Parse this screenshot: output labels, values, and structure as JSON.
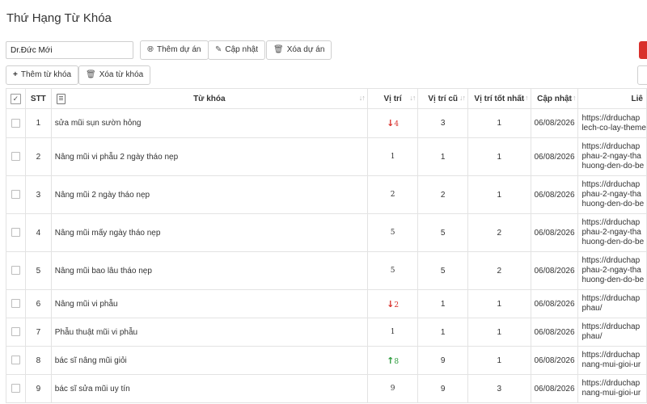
{
  "page": {
    "title": "Thứ Hạng Từ Khóa"
  },
  "project": {
    "selected": "Dr.Đức Mới"
  },
  "toolbar": {
    "add_project": "Thêm dự án",
    "update": "Cập nhật",
    "delete_project": "Xóa dự án",
    "add_keyword": "Thêm từ khóa",
    "delete_keyword": "Xóa từ khóa"
  },
  "colors": {
    "down": "#d9302c",
    "up": "#2a9a3a",
    "danger_button": "#d9302c"
  },
  "table": {
    "headers": {
      "stt": "STT",
      "keyword": "Từ khóa",
      "position": "Vị trí",
      "old_position": "Vị trí cũ",
      "best_position": "Vị trí tốt nhất",
      "updated": "Cập nhật",
      "link": "Liê"
    },
    "rows": [
      {
        "stt": "1",
        "keyword": "sửa mũi sụn sườn hỏng",
        "trend": "down",
        "position": "4",
        "old": "3",
        "best": "1",
        "date": "06/08/2026",
        "url": [
          "https://drduchap",
          "lech-co-lay-theme"
        ]
      },
      {
        "stt": "2",
        "keyword": "Nâng mũi vi phẫu 2 ngày tháo nẹp",
        "trend": "",
        "position": "1",
        "old": "1",
        "best": "1",
        "date": "06/08/2026",
        "url": [
          "https://drduchap",
          "phau-2-ngay-tha",
          "huong-den-do-be"
        ]
      },
      {
        "stt": "3",
        "keyword": "Nâng mũi 2 ngày tháo nẹp",
        "trend": "",
        "position": "2",
        "old": "2",
        "best": "1",
        "date": "06/08/2026",
        "url": [
          "https://drduchap",
          "phau-2-ngay-tha",
          "huong-den-do-be"
        ]
      },
      {
        "stt": "4",
        "keyword": "Nâng mũi mấy ngày tháo nẹp",
        "trend": "",
        "position": "5",
        "old": "5",
        "best": "2",
        "date": "06/08/2026",
        "url": [
          "https://drduchap",
          "phau-2-ngay-tha",
          "huong-den-do-be"
        ]
      },
      {
        "stt": "5",
        "keyword": "Nâng mũi bao lâu tháo nẹp",
        "trend": "",
        "position": "5",
        "old": "5",
        "best": "2",
        "date": "06/08/2026",
        "url": [
          "https://drduchap",
          "phau-2-ngay-tha",
          "huong-den-do-be"
        ]
      },
      {
        "stt": "6",
        "keyword": "Nâng mũi vi phẫu",
        "trend": "down",
        "position": "2",
        "old": "1",
        "best": "1",
        "date": "06/08/2026",
        "url": [
          "https://drduchap",
          "phau/"
        ]
      },
      {
        "stt": "7",
        "keyword": "Phẫu thuật mũi vi phẫu",
        "trend": "",
        "position": "1",
        "old": "1",
        "best": "1",
        "date": "06/08/2026",
        "url": [
          "https://drduchap",
          "phau/"
        ]
      },
      {
        "stt": "8",
        "keyword": "bác sĩ nâng mũi giỏi",
        "trend": "up",
        "position": "8",
        "old": "9",
        "best": "1",
        "date": "06/08/2026",
        "url": [
          "https://drduchap",
          "nang-mui-gioi-ur"
        ]
      },
      {
        "stt": "9",
        "keyword": "bác sĩ sửa mũi uy tín",
        "trend": "",
        "position": "9",
        "old": "9",
        "best": "3",
        "date": "06/08/2026",
        "url": [
          "https://drduchap",
          "nang-mui-gioi-ur"
        ]
      }
    ]
  }
}
